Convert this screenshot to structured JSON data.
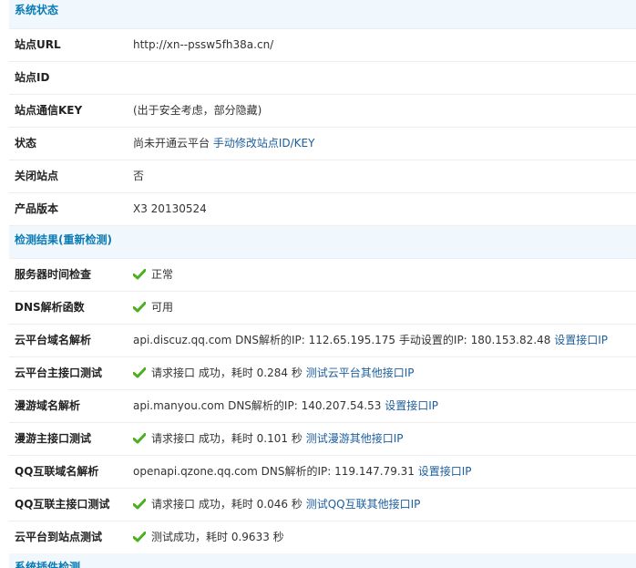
{
  "sections": {
    "system_status": "系统状态",
    "check_results_prefix": "检测结果(",
    "recheck": "重新检测",
    "check_results_suffix": ")",
    "plugin_check": "系统插件检测"
  },
  "status": {
    "site_url": {
      "label": "站点URL",
      "value": "http://xn--pssw5fh38a.cn/"
    },
    "site_id": {
      "label": "站点ID",
      "value": ""
    },
    "site_key": {
      "label": "站点通信KEY",
      "value": "(出于安全考虑，部分隐藏)"
    },
    "state": {
      "label": "状态",
      "value": "尚未开通云平台",
      "link": "手动修改站点ID/KEY"
    },
    "close_site": {
      "label": "关闭站点",
      "value": "否"
    },
    "version": {
      "label": "产品版本",
      "value": "X3 20130524"
    }
  },
  "checks": {
    "server_time": {
      "label": "服务器时间检查",
      "value": "正常"
    },
    "dns_func": {
      "label": "DNS解析函数",
      "value": "可用"
    },
    "cloud_dns": {
      "label": "云平台域名解析",
      "host": "api.discuz.qq.com",
      "dns_label": "DNS解析的IP:",
      "dns_ip": "112.65.195.175",
      "manual_label": "手动设置的IP:",
      "manual_ip": "180.153.82.48",
      "link": "设置接口IP"
    },
    "cloud_api": {
      "label": "云平台主接口测试",
      "prefix": "请求接口 成功，耗时",
      "time": "0.284",
      "unit": "秒",
      "link": "测试云平台其他接口IP"
    },
    "manyou_dns": {
      "label": "漫游域名解析",
      "host": "api.manyou.com",
      "dns_label": "DNS解析的IP:",
      "dns_ip": "140.207.54.53",
      "link": "设置接口IP"
    },
    "manyou_api": {
      "label": "漫游主接口测试",
      "prefix": "请求接口 成功，耗时",
      "time": "0.101",
      "unit": "秒",
      "link": "测试漫游其他接口IP"
    },
    "qq_dns": {
      "label": "QQ互联域名解析",
      "host": "openapi.qzone.qq.com",
      "dns_label": "DNS解析的IP:",
      "dns_ip": "119.147.79.31",
      "link": "设置接口IP"
    },
    "qq_api": {
      "label": "QQ互联主接口测试",
      "prefix": "请求接口 成功，耗时",
      "time": "0.046",
      "unit": "秒",
      "link": "测试QQ互联其他接口IP"
    },
    "cloud_to_site": {
      "label": "云平台到站点测试",
      "prefix": "测试成功，耗时",
      "time": "0.9633",
      "unit": "秒"
    }
  },
  "colors": {
    "header_bg": "#f0f7fd",
    "header_text": "#0b7bb5",
    "link": "#1d5e9c",
    "check": "#4caf1f"
  }
}
